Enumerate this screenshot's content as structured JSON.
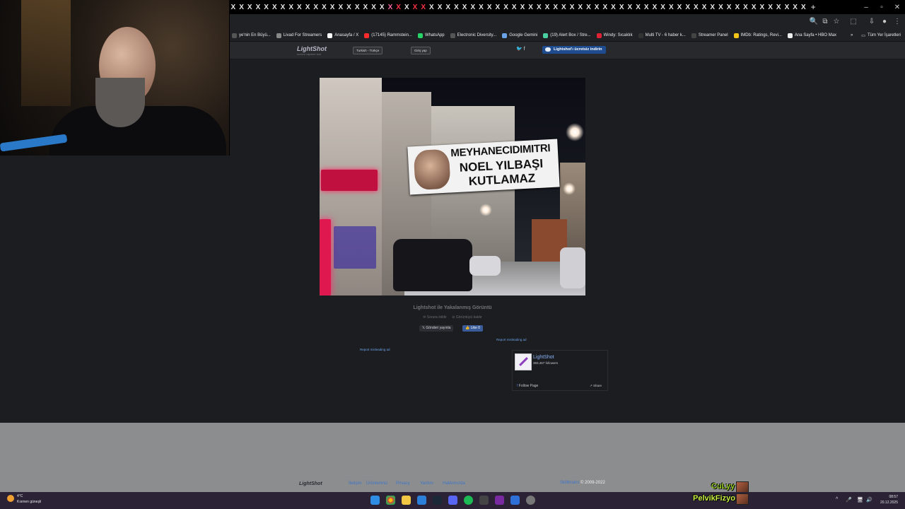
{
  "browser": {
    "tab_glyph": "X",
    "new_tab": "+",
    "window_controls": [
      "–",
      "▫",
      "✕"
    ],
    "bookmarks": [
      {
        "label": "ye'nin En Büyü...",
        "color": "#555"
      },
      {
        "label": "Livad For Streamers",
        "color": "#888"
      },
      {
        "label": "Anasayfa / X",
        "color": "#fff"
      },
      {
        "label": "(17145) Rammstein...",
        "color": "#ff2b2b"
      },
      {
        "label": "WhatsApp",
        "color": "#25d366"
      },
      {
        "label": "Electronic Diversity...",
        "color": "#555"
      },
      {
        "label": "Google Gemini",
        "color": "#6aa2e8"
      },
      {
        "label": "(19) Alert Box / Stre...",
        "color": "#4ad0a0"
      },
      {
        "label": "Windy: Sıcaklık",
        "color": "#d23"
      },
      {
        "label": "Multi TV - 6 haber k...",
        "color": "#333"
      },
      {
        "label": "Streamer Panel",
        "color": "#444"
      },
      {
        "label": "IMDb: Ratings, Revi...",
        "color": "#f5c518"
      },
      {
        "label": "Ana Sayfa • HBO Max",
        "color": "#eee"
      }
    ],
    "bookmarks_more": "»",
    "all_bookmarks": "Tüm Yer İşaretleri"
  },
  "lightshot": {
    "logo": "LightShot",
    "logo_tagline": "screen capture tool",
    "language": "Turkish - Türkçe",
    "login": "Giriş yap",
    "social": "🐦 f",
    "download": "Lightshot'ı ücretsiz indirin",
    "banner_line1": "MEYHANECIDIMITRI",
    "banner_line2": "NOEL YILBAŞI",
    "banner_line3": "KUTLAMAZ",
    "caption": "Lightshot ile Yakalanmış Görüntü",
    "action_report": "✉ Sorunu bildir",
    "action_block": "⊘ Görüntüyü kaldır",
    "share": "Gönderi yayınla",
    "like": "Like 0",
    "report_ad_1": "Report misleading ad",
    "report_ad_2": "Report misleading ad"
  },
  "facebook": {
    "name": "LightShot",
    "followers": "383,467 followers",
    "follow": "Follow Page",
    "share": "Share"
  },
  "footer": {
    "logo": "LightShot",
    "links": [
      "İletişim",
      "Ürünlerimiz",
      "Privacy",
      "Yardım",
      "Hakkımızda"
    ],
    "skillbrains": "Skillbrains",
    "copyright": "© 2009-2022"
  },
  "taskbar": {
    "temp": "4°C",
    "weather": "Kısmen güneşli",
    "time": "08:57",
    "date": "20.12.2025"
  },
  "overlay": {
    "name1": "CuLyy",
    "name2": "PelvikFizyo"
  }
}
